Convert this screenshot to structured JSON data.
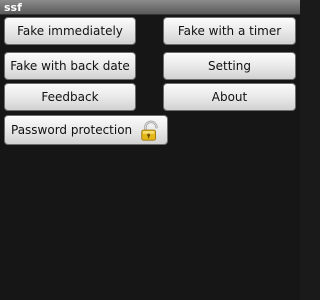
{
  "window": {
    "title": "ssf"
  },
  "buttons": {
    "fake_immediately": "Fake immediately",
    "fake_with_timer": "Fake with a timer",
    "fake_with_back_date": "Fake with back date",
    "setting": "Setting",
    "feedback": "Feedback",
    "about": "About",
    "password_protection": "Password protection"
  },
  "icons": {
    "password_protection": "lock-icon"
  },
  "colors": {
    "background": "#161616",
    "title_bar": "#6f6f6f",
    "button_face": "#e9e9e9",
    "lock_gold": "#e5b81a"
  }
}
